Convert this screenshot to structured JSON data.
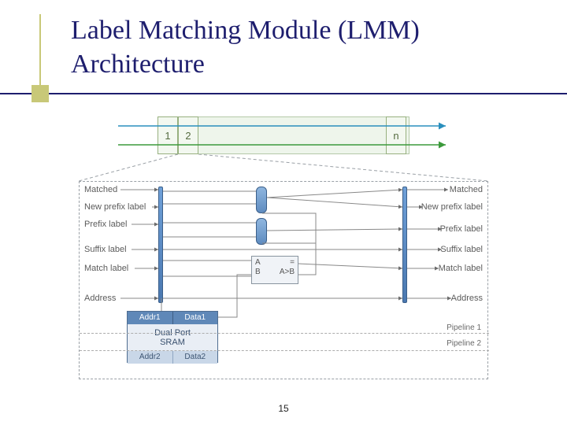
{
  "title_line1": "Label Matching Module (LMM)",
  "title_line2": "Architecture",
  "page_number": "15",
  "stages": {
    "first": "1",
    "second": "2",
    "last": "n"
  },
  "signals_left": {
    "matched": "Matched",
    "new_prefix": "New prefix label",
    "prefix": "Prefix label",
    "suffix": "Suffix label",
    "match": "Match label",
    "address": "Address"
  },
  "signals_right": {
    "matched": "Matched",
    "new_prefix": "New prefix label",
    "prefix": "Prefix label",
    "suffix": "Suffix label",
    "match": "Match label",
    "address": "Address"
  },
  "comparator": {
    "a": "A",
    "b": "B",
    "eq": "=",
    "gt": "A>B"
  },
  "memory": {
    "addr1": "Addr1",
    "data1": "Data1",
    "name_l1": "Dual Port",
    "name_l2": "SRAM",
    "addr2": "Addr2",
    "data2": "Data2"
  },
  "pipelines": {
    "p1": "Pipeline 1",
    "p2": "Pipeline 2"
  }
}
